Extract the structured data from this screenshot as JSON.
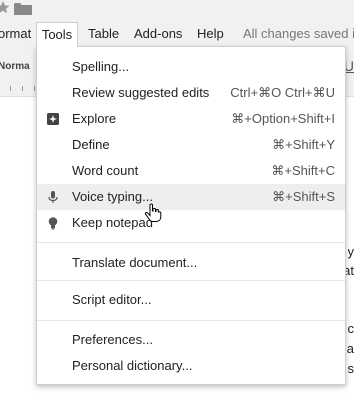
{
  "header": {
    "star_icon": "star-icon",
    "folder_icon": "folder-icon"
  },
  "menubar": {
    "items": [
      {
        "label": "ormat"
      },
      {
        "label": "Tools"
      },
      {
        "label": "Table"
      },
      {
        "label": "Add-ons"
      },
      {
        "label": "Help"
      }
    ],
    "status": "All changes saved in"
  },
  "toolbar": {
    "style_label": "Norma",
    "underline_label": "U"
  },
  "tools_menu": {
    "items": [
      {
        "label": "Spelling...",
        "shortcut": ""
      },
      {
        "label": "Review suggested edits",
        "shortcut": "Ctrl+⌘O Ctrl+⌘U"
      },
      {
        "label": "Explore",
        "shortcut": "⌘+Option+Shift+I",
        "icon": "explore-icon"
      },
      {
        "label": "Define",
        "shortcut": "⌘+Shift+Y"
      },
      {
        "label": "Word count",
        "shortcut": "⌘+Shift+C"
      },
      {
        "label": "Voice typing...",
        "shortcut": "⌘+Shift+S",
        "icon": "microphone-icon"
      },
      {
        "label": "Keep notepad",
        "shortcut": "",
        "icon": "lightbulb-icon"
      },
      {
        "label": "Translate document...",
        "shortcut": ""
      },
      {
        "label": "Script editor...",
        "shortcut": ""
      },
      {
        "label": "Preferences...",
        "shortcut": ""
      },
      {
        "label": "Personal dictionary...",
        "shortcut": ""
      }
    ]
  },
  "document": {
    "fragments": [
      "y",
      "at",
      "c",
      "d a",
      "s"
    ]
  },
  "colors": {
    "menu_hover": "#eeeeee",
    "chrome_bg": "#f1f1f1",
    "status_text": "#777777"
  }
}
